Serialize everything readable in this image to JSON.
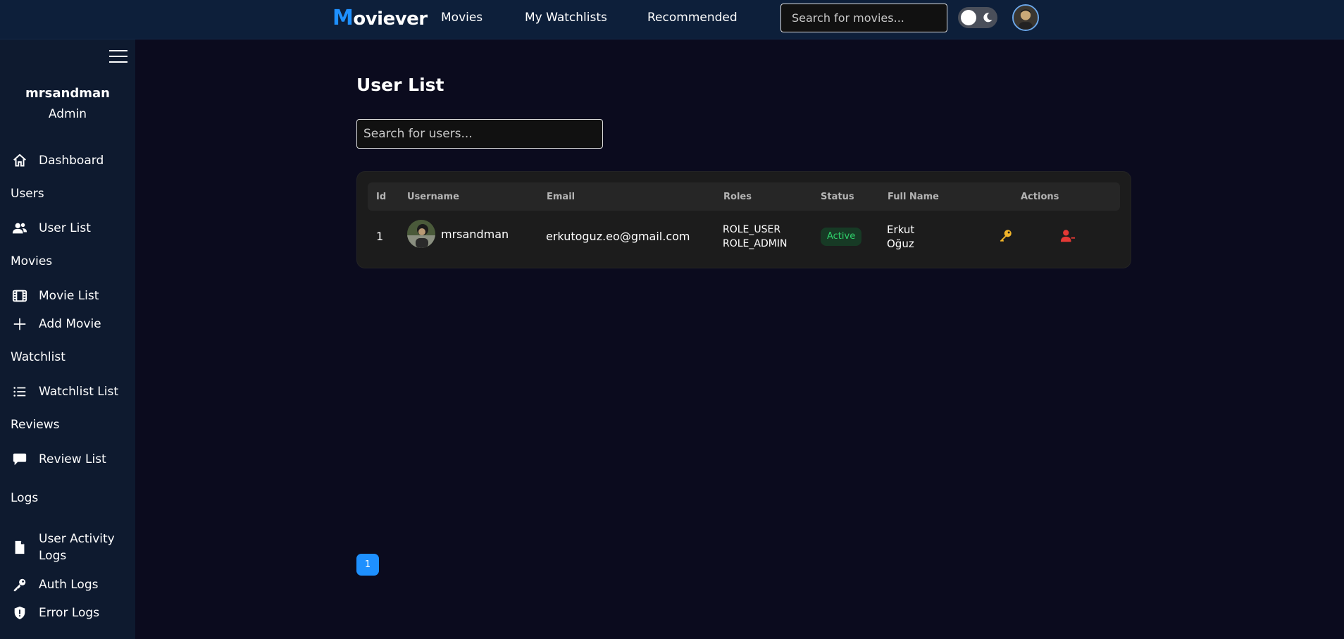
{
  "navbar": {
    "brand_first": "M",
    "brand_rest": "oviever",
    "links": [
      "Movies",
      "My Watchlists",
      "Recommended"
    ],
    "search_placeholder": "Search for movies..."
  },
  "sidebar": {
    "user_name": "mrsandman",
    "user_role": "Admin",
    "sections": {
      "users": "Users",
      "movies": "Movies",
      "watchlist": "Watchlist",
      "reviews": "Reviews",
      "logs": "Logs"
    },
    "items": {
      "dashboard": "Dashboard",
      "user_list": "User List",
      "movie_list": "Movie List",
      "add_movie": "Add Movie",
      "watchlist_list": "Watchlist List",
      "review_list": "Review List",
      "user_activity_logs_1": "User Activity",
      "user_activity_logs_2": "Logs",
      "auth_logs": "Auth Logs",
      "error_logs": "Error Logs"
    }
  },
  "main": {
    "title": "User List",
    "search_placeholder": "Search for users...",
    "columns": [
      "Id",
      "Username",
      "Email",
      "Roles",
      "Status",
      "Full Name",
      "Actions"
    ],
    "rows": [
      {
        "id": "1",
        "username": "mrsandman",
        "email": "erkutoguz.eo@gmail.com",
        "roles": [
          "ROLE_USER",
          "ROLE_ADMIN"
        ],
        "status": "Active",
        "full_name": [
          "Erkut",
          "Oğuz"
        ]
      }
    ],
    "pagination": [
      "1"
    ]
  },
  "colors": {
    "accent": "#1e90ff",
    "navbar_bg": "#0d1f3a",
    "sidebar_bg": "#0e1a2f",
    "page_bg": "#0b0b1e",
    "status_active": "#2fcf6a",
    "key_action": "#f0b429",
    "remove_action": "#e53935"
  },
  "icons": {
    "dashboard": "home-icon",
    "user_list": "users-icon",
    "movie_list": "film-icon",
    "add_movie": "plus-icon",
    "watchlist_list": "list-icon",
    "review_list": "speech-bubble-icon",
    "user_activity_logs": "file-icon",
    "auth_logs": "key-icon",
    "error_logs": "shield-icon",
    "theme_toggle": "moon-icon",
    "row_action_1": "key-icon",
    "row_action_2": "user-remove-icon"
  }
}
